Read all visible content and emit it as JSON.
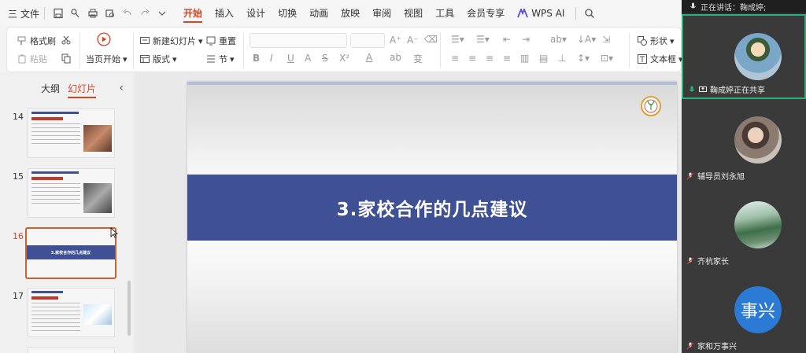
{
  "menubar": {
    "menu_label": "三",
    "file_label": "文件",
    "tabs": [
      "开始",
      "插入",
      "设计",
      "切换",
      "动画",
      "放映",
      "审阅",
      "视图",
      "工具",
      "会员专享"
    ],
    "ai_label": "WPS AI"
  },
  "ribbon": {
    "format_painter": "格式刷",
    "paste": "粘贴",
    "from_start": "当页开始",
    "new_slide": "新建幻灯片",
    "reset": "重置",
    "layout": "版式",
    "section": "节",
    "shape": "形状",
    "textbox": "文本框",
    "font_glyphs": [
      "B",
      "I",
      "U",
      "A",
      "S",
      "X²",
      "A",
      "ab",
      "变"
    ]
  },
  "panel": {
    "outline_tab": "大纲",
    "slides_tab": "幻灯片",
    "collapse": "‹",
    "slide_numbers": [
      "14",
      "15",
      "16",
      "17"
    ],
    "current_slide_title": "3.家校合作的几点建议"
  },
  "slide": {
    "title": "3.家校合作的几点建议"
  },
  "meeting": {
    "speaking_label": "正在讲话：鞠成婷;",
    "participants": [
      {
        "name": "鞠成婷正在共享",
        "active": true
      },
      {
        "name": "辅导员刘永旭",
        "active": false
      },
      {
        "name": "齐杭家长",
        "active": false
      },
      {
        "name": "家和万事兴",
        "active": false,
        "avatar_text": "事兴"
      }
    ]
  },
  "colors": {
    "accent": "#d24726",
    "slide_band": "#3f5194",
    "active_tile_border": "#24b37a",
    "avatar_blue": "#2b7ad6"
  }
}
